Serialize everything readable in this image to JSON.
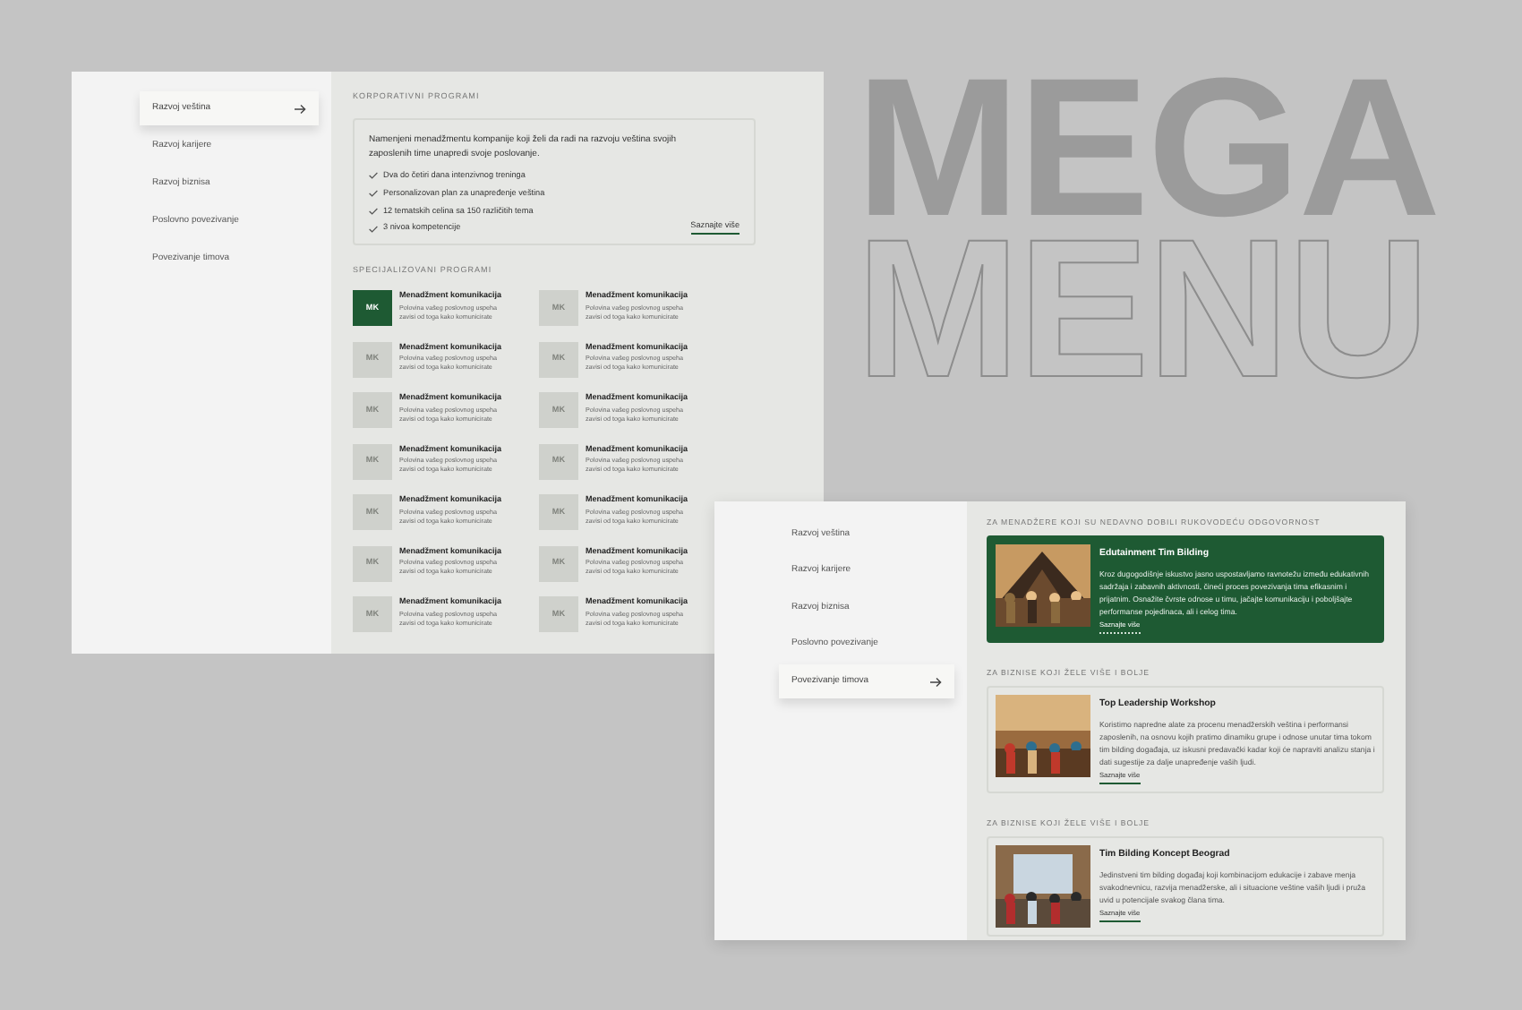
{
  "headline": {
    "filled": "MEGA",
    "outline": "MENU"
  },
  "menu_1": {
    "sidebar": {
      "items": [
        {
          "label": "Razvoj veština",
          "selected": true
        },
        {
          "label": "Razvoj karijere",
          "selected": false
        },
        {
          "label": "Razvoj biznisa",
          "selected": false
        },
        {
          "label": "Poslovno povezivanje",
          "selected": false
        },
        {
          "label": "Povezivanje timova",
          "selected": false
        }
      ]
    },
    "corporate": {
      "heading": "KORPORATIVNI PROGRAMI",
      "description": "Namenjeni menadžmentu kompanije koji želi da radi na razvoju veština svojih zaposlenih time unapredi svoje poslovanje.",
      "features": [
        "Dva do četiri dana intenzivnog treninga",
        "Personalizovan plan za unapređenje veština",
        "12 tematskih celina sa 150 različitih tema",
        "3 nivoa kompetencije"
      ],
      "link": "Saznajte više"
    },
    "specialized": {
      "heading": "SPECIJALIZOVANI PROGRAMI",
      "programs": [
        {
          "initials": "MK",
          "title": "Menadžment komunikacija",
          "description": "Polovina vašeg poslovnog uspeha zavisi od toga kako komunicirate",
          "selected": true
        },
        {
          "initials": "MK",
          "title": "Menadžment komunikacija",
          "description": "Polovina vašeg poslovnog uspeha zavisi od toga kako komunicirate",
          "selected": false
        },
        {
          "initials": "MK",
          "title": "Menadžment komunikacija",
          "description": "Polovina vašeg poslovnog uspeha zavisi od toga kako komunicirate",
          "selected": false
        },
        {
          "initials": "MK",
          "title": "Menadžment komunikacija",
          "description": "Polovina vašeg poslovnog uspeha zavisi od toga kako komunicirate",
          "selected": false
        },
        {
          "initials": "MK",
          "title": "Menadžment komunikacija",
          "description": "Polovina vašeg poslovnog uspeha zavisi od toga kako komunicirate",
          "selected": false
        },
        {
          "initials": "MK",
          "title": "Menadžment komunikacija",
          "description": "Polovina vašeg poslovnog uspeha zavisi od toga kako komunicirate",
          "selected": false
        },
        {
          "initials": "MK",
          "title": "Menadžment komunikacija",
          "description": "Polovina vašeg poslovnog uspeha zavisi od toga kako komunicirate",
          "selected": false
        },
        {
          "initials": "MK",
          "title": "Menadžment komunikacija",
          "description": "Polovina vašeg poslovnog uspeha zavisi od toga kako komunicirate",
          "selected": false
        },
        {
          "initials": "MK",
          "title": "Menadžment komunikacija",
          "description": "Polovina vašeg poslovnog uspeha zavisi od toga kako komunicirate",
          "selected": false
        },
        {
          "initials": "MK",
          "title": "Menadžment komunikacija",
          "description": "Polovina vašeg poslovnog uspeha zavisi od toga kako komunicirate",
          "selected": false
        },
        {
          "initials": "MK",
          "title": "Menadžment komunikacija",
          "description": "Polovina vašeg poslovnog uspeha zavisi od toga kako komunicirate",
          "selected": false
        },
        {
          "initials": "MK",
          "title": "Menadžment komunikacija",
          "description": "Polovina vašeg poslovnog uspeha zavisi od toga kako komunicirate",
          "selected": false
        },
        {
          "initials": "MK",
          "title": "Menadžment komunikacija",
          "description": "Polovina vašeg poslovnog uspeha zavisi od toga kako komunicirate",
          "selected": false
        },
        {
          "initials": "MK",
          "title": "Menadžment komunikacija",
          "description": "Polovina vašeg poslovnog uspeha zavisi od toga kako komunicirate",
          "selected": false
        }
      ]
    }
  },
  "menu_2": {
    "sidebar": {
      "items": [
        {
          "label": "Razvoj veština",
          "selected": false
        },
        {
          "label": "Razvoj karijere",
          "selected": false
        },
        {
          "label": "Razvoj biznisa",
          "selected": false
        },
        {
          "label": "Poslovno povezivanje",
          "selected": false
        },
        {
          "label": "Povezivanje timova",
          "selected": true
        }
      ]
    },
    "sections": [
      {
        "heading": "ZA MENADŽERE KOJI SU NEDAVNO DOBILI RUKOVODEĆU ODGOVORNOST",
        "card": {
          "title": "Edutainment Tim Bilding",
          "text": "Kroz dugogodišnje iskustvo jasno uspostavljamo ravnotežu između edukativnih sadržaja i zabavnih aktivnosti, čineći proces povezivanja tima efikasnim i prijatnim. Osnažite čvrste odnose u timu, jačajte komunikaciju i poboljšajte performanse pojedinaca, ali i celog tima.",
          "link": "Saznajte više",
          "highlighted": true
        }
      },
      {
        "heading": "ZA BIZNISE KOJI ŽELE VIŠE I BOLJE",
        "card": {
          "title": "Top Leadership Workshop",
          "text": "Koristimo napredne alate za procenu menadžerskih veština i performansi zaposlenih, na osnovu kojih pratimo dinamiku grupe i odnose unutar tima tokom tim bilding događaja, uz iskusni predavački kadar koji će napraviti analizu stanja i dati sugestije za dalje unapređenje vaših ljudi.",
          "link": "Saznajte više",
          "highlighted": false
        }
      },
      {
        "heading": "ZA BIZNISE KOJI ŽELE VIŠE I BOLJE",
        "card": {
          "title": "Tim Bilding Koncept Beograd",
          "text": "Jedinstveni tim bilding događaj koji kombinacijom edukacije i zabave menja svakodnevnicu, razvija menadžerske, ali i situacione veštine vaših ljudi i pruža uvid u potencijale svakog člana tima.",
          "link": "Saznajte više",
          "highlighted": false
        }
      }
    ]
  }
}
